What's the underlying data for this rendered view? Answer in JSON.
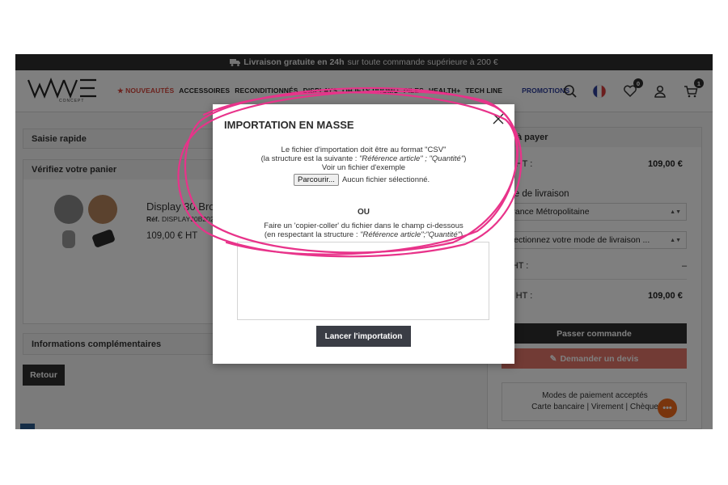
{
  "promo_bar": {
    "bold": "Livraison gratuite en 24h",
    "rest": "sur toute commande supérieure à 200 €"
  },
  "header": {
    "logo_text": "WAVE",
    "logo_sub": "CONCEPT",
    "nav": [
      "★ NOUVEAUTÉS",
      "ACCESSOIRES",
      "RECONDITIONNÉS",
      "DISPLAYS",
      "OBJETS PROMO",
      "PILES",
      "HEALTH+",
      "TECH LINE"
    ],
    "promotions": "PROMOTIONS",
    "wishlist_count": "0",
    "cart_count": "1"
  },
  "left": {
    "saisie": "Saisie rapide",
    "verify": "Vérifiez votre panier",
    "product_name": "Display 30 Bro",
    "product_ref_label": "Réf.",
    "product_ref": "DISPLAY30B202",
    "product_price": "109,00 € HT",
    "info": "Informations complémentaires",
    "back": "Retour"
  },
  "right": {
    "total_title": "à payer",
    "total_ht_label": "tal HT :",
    "total_ht_value": "109,00 €",
    "shipping_title": "ode de livraison",
    "country": "France Métropolitaine",
    "shipping_select": "électionnez votre mode de livraison ...",
    "port_label": "rt HT :",
    "port_value": "–",
    "total2_label": "tal HT :",
    "total2_value": "109,00 €",
    "order": "Passer commande",
    "quote": "Demander un devis",
    "payment_title": "Modes de paiement acceptés",
    "payment_list": "Carte bancaire | Virement | Chèque"
  },
  "modal": {
    "title": "IMPORTATION EN MASSE",
    "line1": "Le fichier d'importation doit être au format \"CSV\"",
    "line2_a": "(la structure est la suivante : ",
    "line2_i": "\"Référence article\" ; \"Quantité\"",
    "line2_b": ")",
    "line3": "Voir un fichier d'exemple",
    "browse": "Parcourir...",
    "no_file": "Aucun fichier sélectionné.",
    "or": "OU",
    "line4": "Faire un 'copier-coller' du fichier dans le champ ci-dessous",
    "line5_a": "(en respectant la structure : ",
    "line5_i": "\"Référence article\";\"Quantité\"",
    "line5_b": ")",
    "launch": "Lancer l'importation"
  },
  "colors": {
    "annotation": "#e8338a",
    "chat": "#f26a1b",
    "quote": "#e5776b"
  }
}
